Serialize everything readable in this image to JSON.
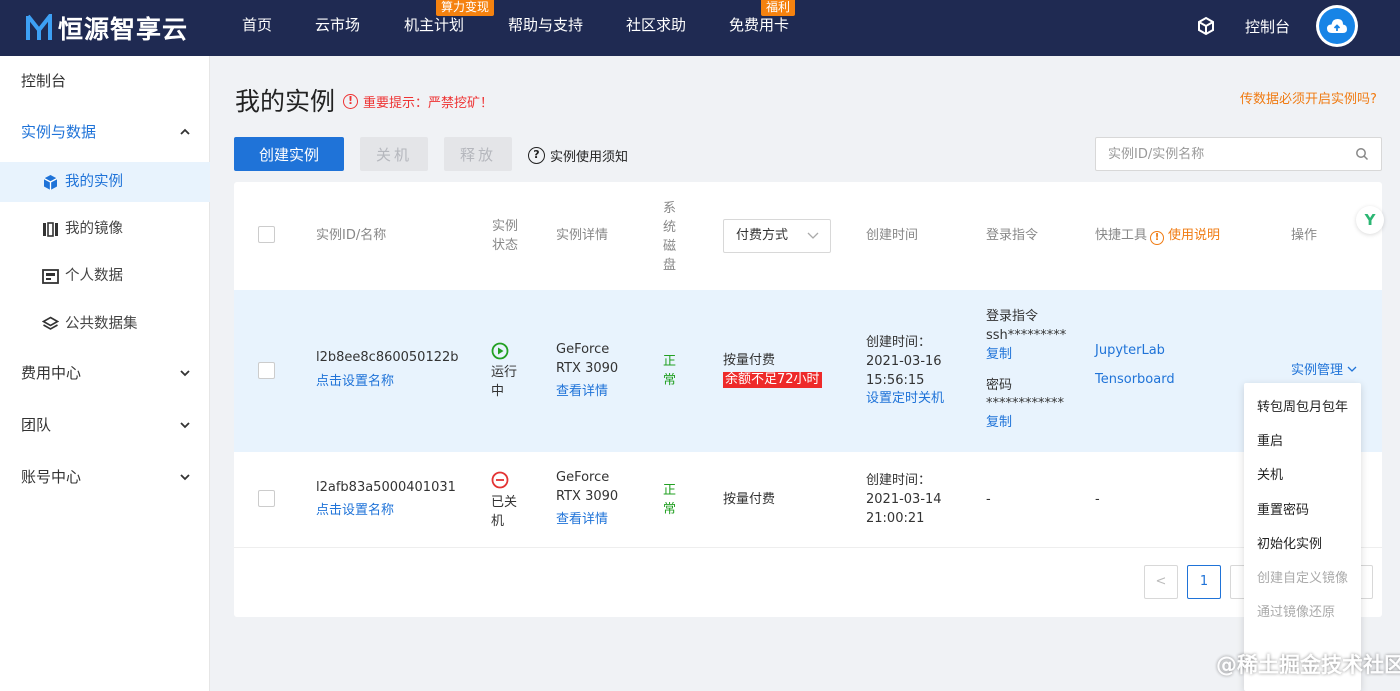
{
  "brand": {
    "name": "恒源智享云"
  },
  "nav": {
    "items": [
      "首页",
      "云市场",
      "机主计划",
      "帮助与支持",
      "社区求助",
      "免费用卡"
    ],
    "badges": {
      "mining": "算力变现",
      "welfare": "福利"
    },
    "console": "控制台"
  },
  "sidebar": {
    "console": "控制台",
    "instances_data": "实例与数据",
    "my_instances": "我的实例",
    "my_images": "我的镜像",
    "personal_data": "个人数据",
    "public_datasets": "公共数据集",
    "billing": "费用中心",
    "team": "团队",
    "account": "账号中心"
  },
  "page": {
    "title": "我的实例",
    "warning": "重要提示：严禁挖矿！",
    "hint": "传数据必须开启实例吗?"
  },
  "toolbar": {
    "create": "创建实例",
    "shutdown": "关机",
    "release": "释放",
    "notice": "实例使用须知",
    "search_placeholder": "实例ID/实例名称"
  },
  "table": {
    "headers": {
      "id": "实例ID/名称",
      "status_l1": "实例",
      "status_l2": "状态",
      "details": "实例详情",
      "disk_l1": "系",
      "disk_l2": "统",
      "disk_l3": "磁",
      "disk_l4": "盘",
      "billing_select": "付费方式",
      "created": "创建时间",
      "login": "登录指令",
      "tools": "快捷工具",
      "tools_help": "使用说明",
      "ops": "操作"
    },
    "rows": [
      {
        "id": "l2b8ee8c860050122b",
        "name_link": "点击设置名称",
        "status_l1": "运行",
        "status_l2": "中",
        "gpu_l1": "GeForce",
        "gpu_l2": "RTX 3090",
        "details_link": "查看详情",
        "disk_l1": "正",
        "disk_l2": "常",
        "billing": "按量付费",
        "billing_alert": "余额不足72小时",
        "created_label": "创建时间：",
        "created_date": "2021-03-16",
        "created_time": "15:56:15",
        "timer_link": "设置定时关机",
        "login_label": "登录指令",
        "login_cmd": "ssh*********",
        "copy1": "复制",
        "password_label": "密码",
        "password": "************",
        "copy2": "复制",
        "tool1": "JupyterLab",
        "tool2": "Tensorboard",
        "ops_link": "实例管理"
      },
      {
        "id": "l2afb83a5000401031",
        "name_link": "点击设置名称",
        "status_l1": "已关",
        "status_l2": "机",
        "gpu_l1": "GeForce",
        "gpu_l2": "RTX 3090",
        "details_link": "查看详情",
        "disk_l1": "正",
        "disk_l2": "常",
        "billing": "按量付费",
        "created_label": "创建时间：",
        "created_date": "2021-03-14",
        "created_time": "21:00:21",
        "login": "-",
        "tools": "-"
      }
    ]
  },
  "pagination": {
    "prev": "<",
    "current": "1"
  },
  "dropdown": {
    "items": [
      "转包周包月包年",
      "重启",
      "关机",
      "重置密码",
      "初始化实例",
      "创建自定义镜像",
      "通过镜像还原"
    ]
  },
  "watermark": "@稀土掘金技术社区",
  "colors": {
    "primary": "#1f73d8",
    "topbar": "#1f2a52",
    "warning": "#ee3333",
    "accent": "#f07b12",
    "running": "#22a022",
    "stopped": "#e33333"
  }
}
